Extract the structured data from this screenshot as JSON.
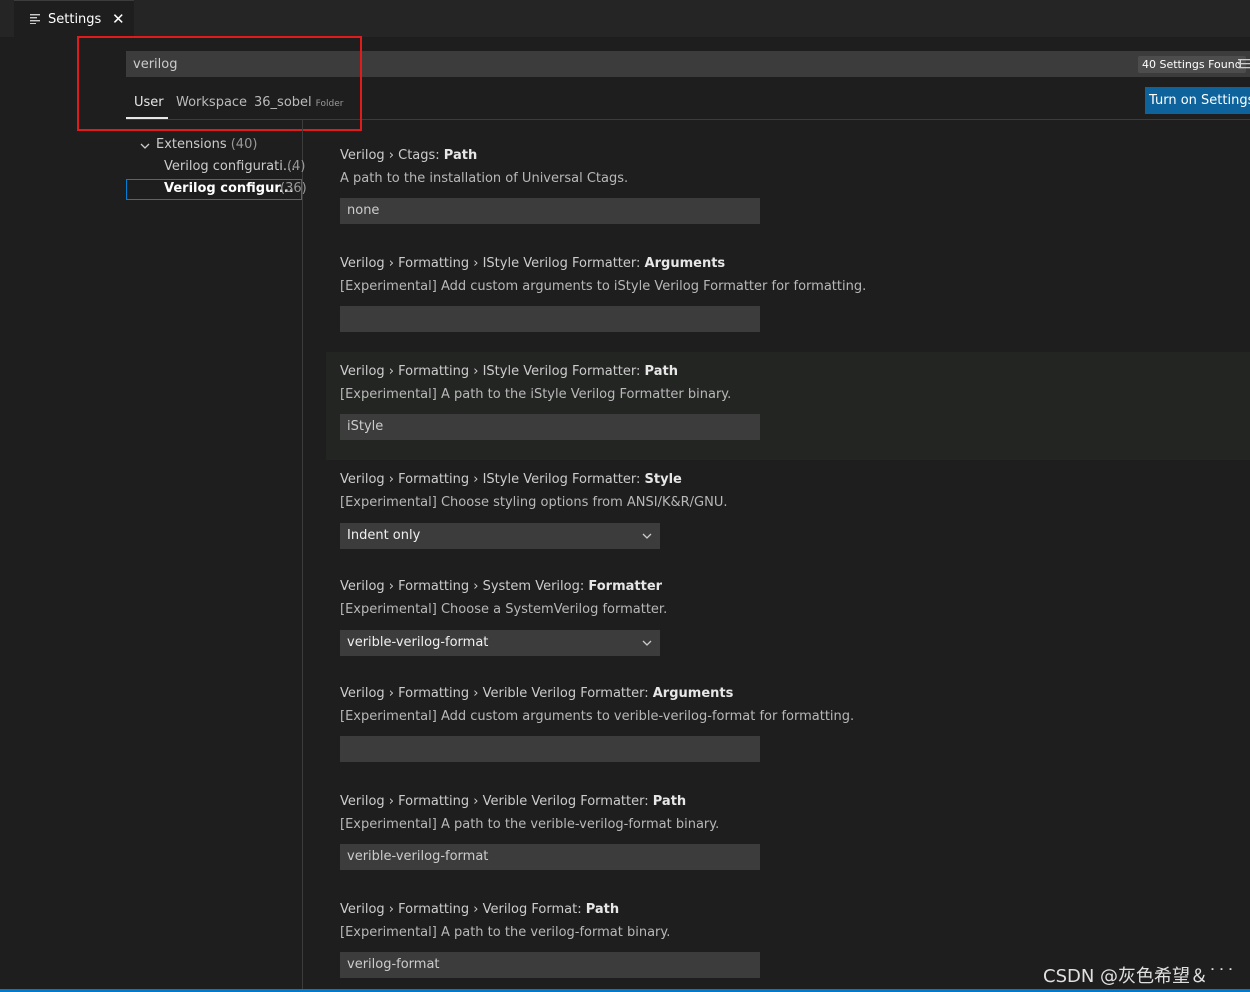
{
  "tab": {
    "title": "Settings",
    "close": "✕",
    "icon": "list-icon"
  },
  "search": {
    "value": "verilog",
    "results_badge": "40 Settings Found",
    "filter_icon": "filter-icon"
  },
  "scopes": {
    "user": "User",
    "workspace": "Workspace",
    "folder": "36_sobel",
    "folder_hint": "Folder"
  },
  "sync_button": "Turn on Settings S",
  "toc": {
    "extensions_label": "Extensions",
    "extensions_count": "(40)",
    "item1_label": "Verilog configurati...",
    "item1_count": "(4)",
    "item2_label": "Verilog configur...",
    "item2_count": "(36)"
  },
  "settings": [
    {
      "category": "Verilog › Ctags: ",
      "name": "Path",
      "description": "A path to the installation of Universal Ctags.",
      "value": "none",
      "type": "text"
    },
    {
      "category": "Verilog › Formatting › IStyle Verilog Formatter: ",
      "name": "Arguments",
      "description": "[Experimental] Add custom arguments to iStyle Verilog Formatter for formatting.",
      "value": "",
      "type": "text"
    },
    {
      "category": "Verilog › Formatting › IStyle Verilog Formatter: ",
      "name": "Path",
      "description": "[Experimental] A path to the iStyle Verilog Formatter binary.",
      "value": "iStyle",
      "type": "text"
    },
    {
      "category": "Verilog › Formatting › IStyle Verilog Formatter: ",
      "name": "Style",
      "description": "[Experimental] Choose styling options from ANSI/K&R/GNU.",
      "value": "Indent only",
      "type": "select"
    },
    {
      "category": "Verilog › Formatting › System Verilog: ",
      "name": "Formatter",
      "description": "[Experimental] Choose a SystemVerilog formatter.",
      "value": "verible-verilog-format",
      "type": "select"
    },
    {
      "category": "Verilog › Formatting › Verible Verilog Formatter: ",
      "name": "Arguments",
      "description": "[Experimental] Add custom arguments to verible-verilog-format for formatting.",
      "value": "",
      "type": "text"
    },
    {
      "category": "Verilog › Formatting › Verible Verilog Formatter: ",
      "name": "Path",
      "description": "[Experimental] A path to the verible-verilog-format binary.",
      "value": "verible-verilog-format",
      "type": "text"
    },
    {
      "category": "Verilog › Formatting › Verilog Format: ",
      "name": "Path",
      "description": "[Experimental] A path to the verilog-format binary.",
      "value": "verilog-format",
      "type": "text"
    }
  ],
  "watermark": "CSDN @灰色希望＆˙˙˙",
  "colors": {
    "accent": "#007fd4",
    "button": "#0e639c",
    "highlight": "#e01b1b"
  }
}
